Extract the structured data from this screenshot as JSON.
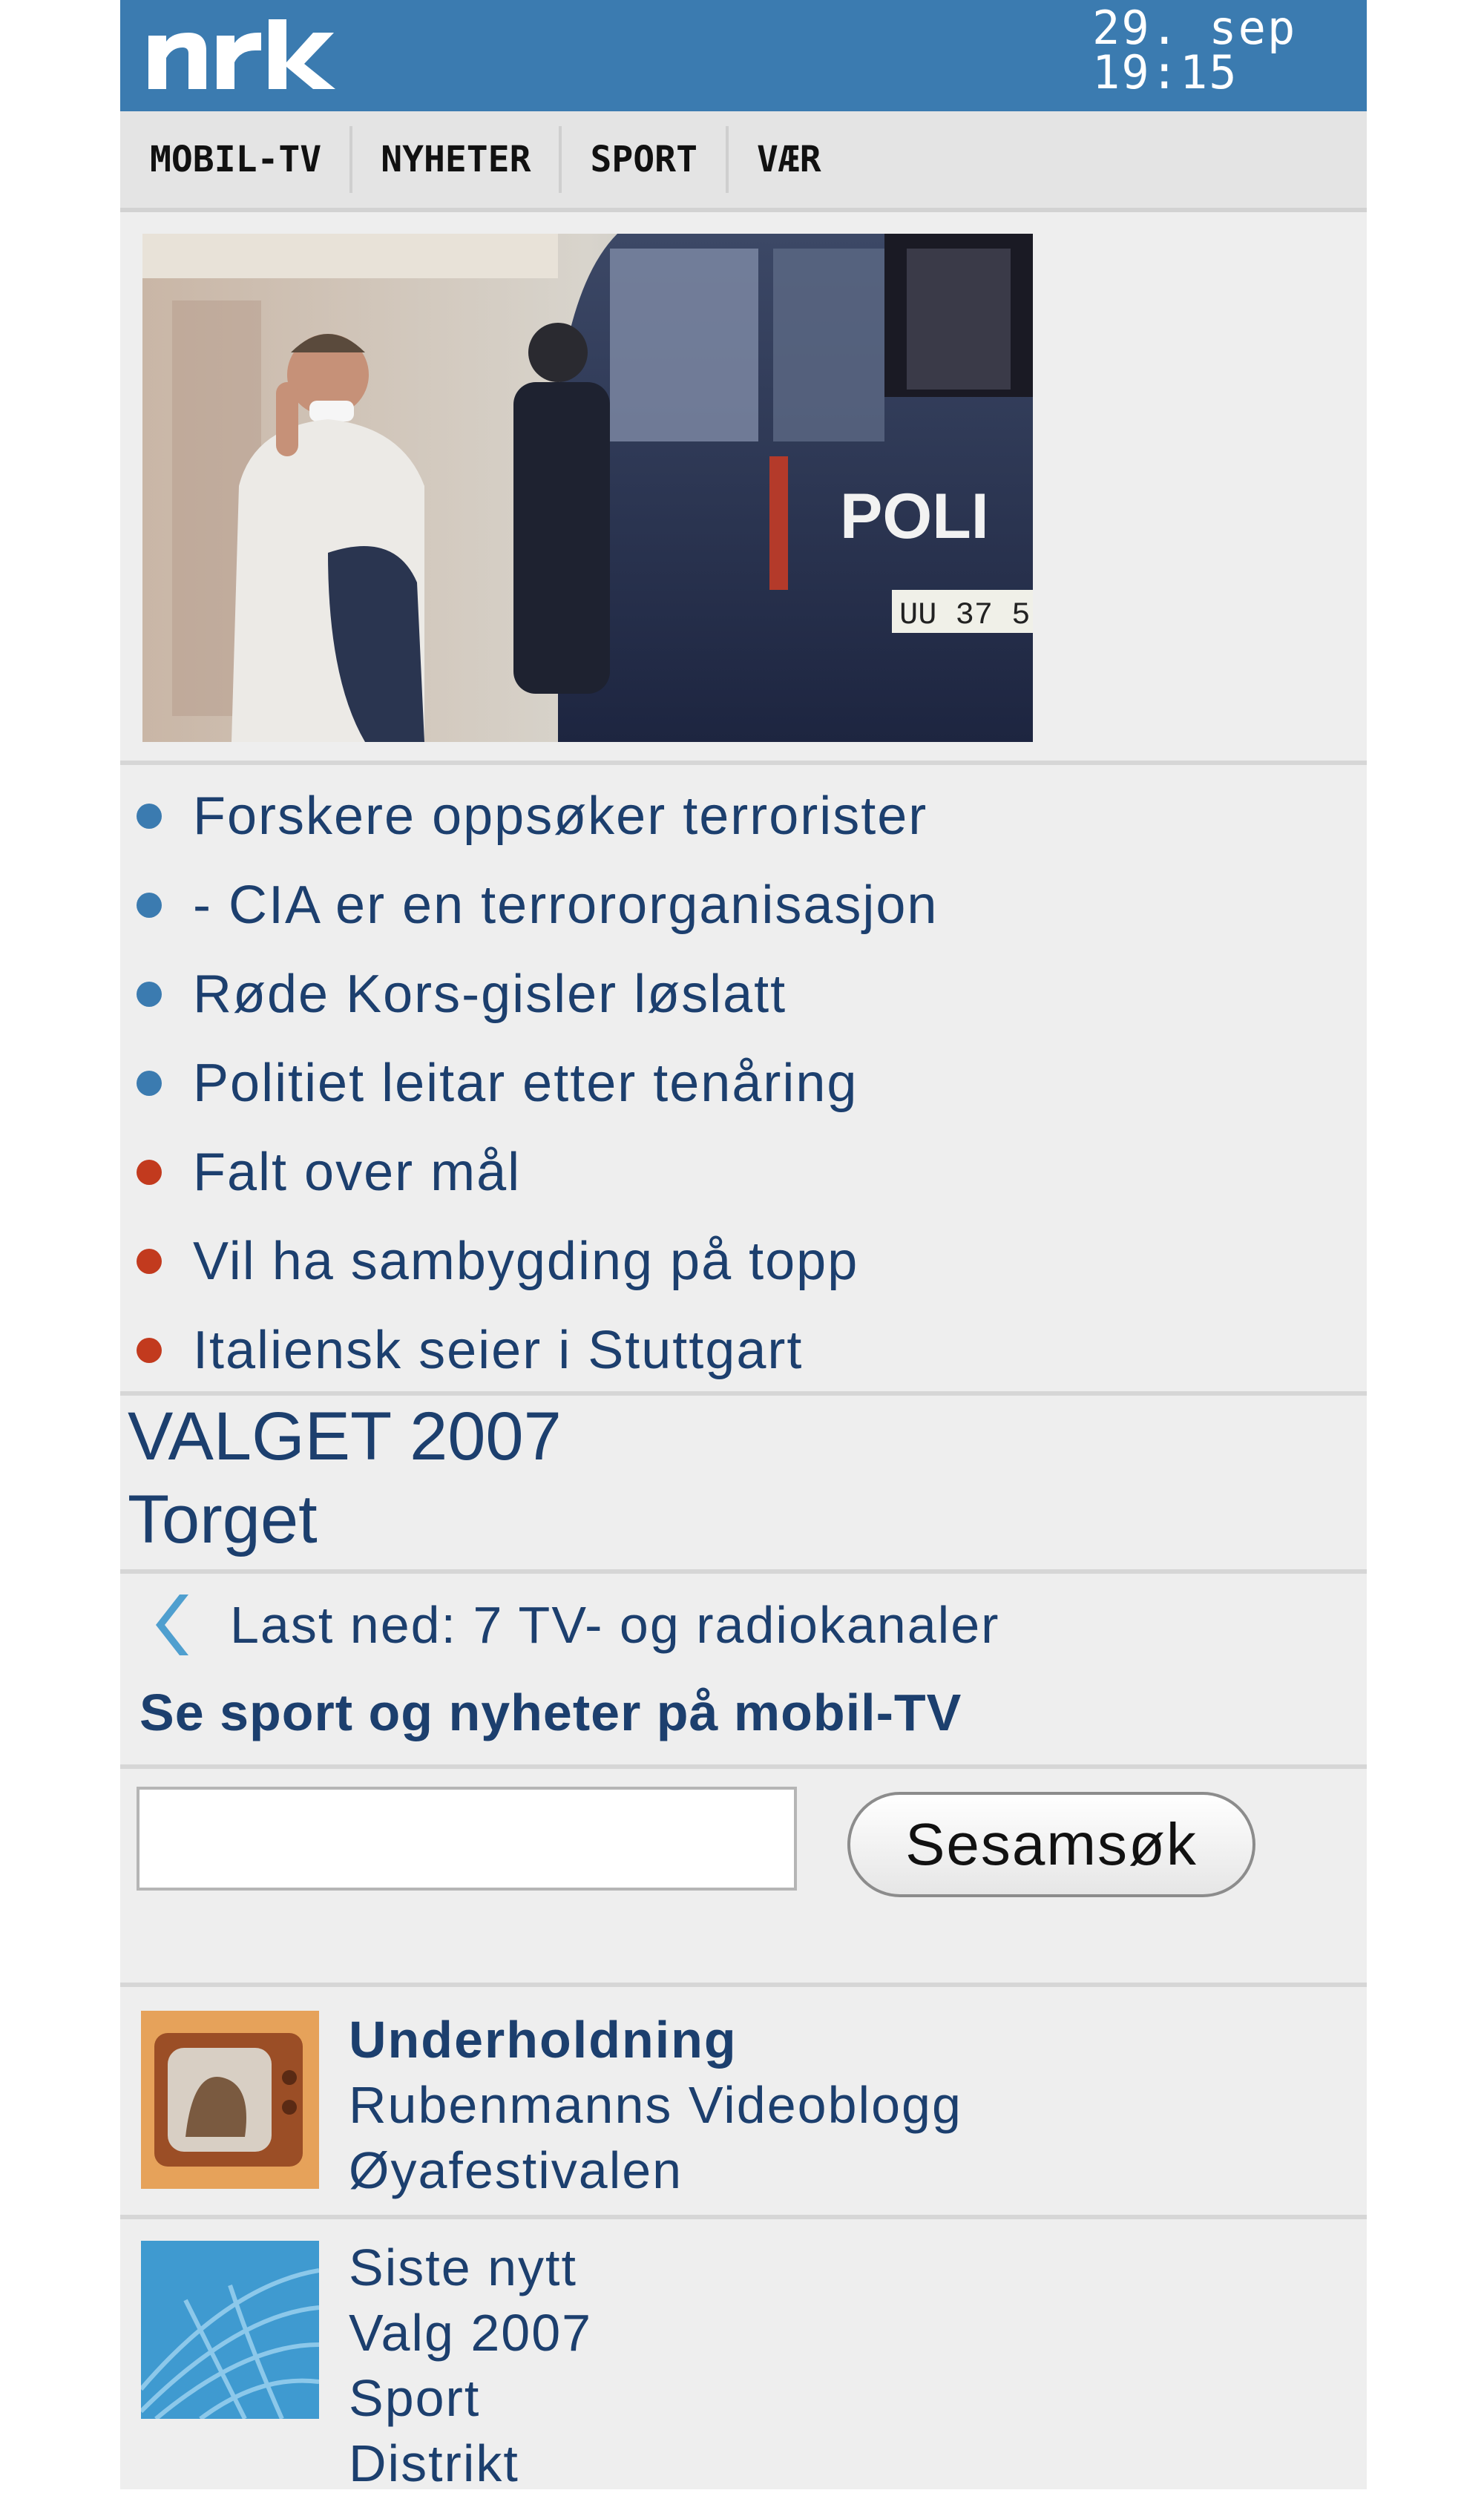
{
  "header": {
    "logo_text": "nrk",
    "date": "29. sep",
    "time": "19:15",
    "brand_color": "#3b7bb0"
  },
  "nav": {
    "items": [
      {
        "label": "MOBIL-TV"
      },
      {
        "label": "NYHETER"
      },
      {
        "label": "SPORT"
      },
      {
        "label": "VÆR"
      }
    ]
  },
  "hero": {
    "image_text": "POLI",
    "plate_text": "UU 37 5"
  },
  "headlines": [
    {
      "text": "Forskere oppsøker terrorister",
      "bullet_color": "#3b7bb0"
    },
    {
      "text": "- CIA er en terrororganisasjon",
      "bullet_color": "#3b7bb0"
    },
    {
      "text": "Røde Kors-gisler løslatt",
      "bullet_color": "#3b7bb0"
    },
    {
      "text": "Politiet leitar etter tenåring",
      "bullet_color": "#3b7bb0"
    },
    {
      "text": "Falt over mål",
      "bullet_color": "#c23a1e"
    },
    {
      "text": "Vil ha sambygding på topp",
      "bullet_color": "#c23a1e"
    },
    {
      "text": "Italiensk seier i Stuttgart",
      "bullet_color": "#c23a1e"
    }
  ],
  "valget": {
    "link1": "VALGET 2007",
    "link2": "Torget"
  },
  "promo": {
    "icon": "chevron-left-icon",
    "line1": "Last ned: 7 TV- og radiokanaler",
    "line2": "Se sport og nyheter på mobil-TV"
  },
  "search": {
    "value": "",
    "button_label": "Sesamsøk"
  },
  "sections": [
    {
      "icon": "tv-icon",
      "items": [
        "Underholdning",
        "Rubenmanns Videoblogg",
        "Øyafestivalen"
      ]
    },
    {
      "icon": "globe-icon",
      "items": [
        "Siste nytt",
        "Valg 2007",
        "Sport",
        "Distrikt"
      ]
    }
  ]
}
